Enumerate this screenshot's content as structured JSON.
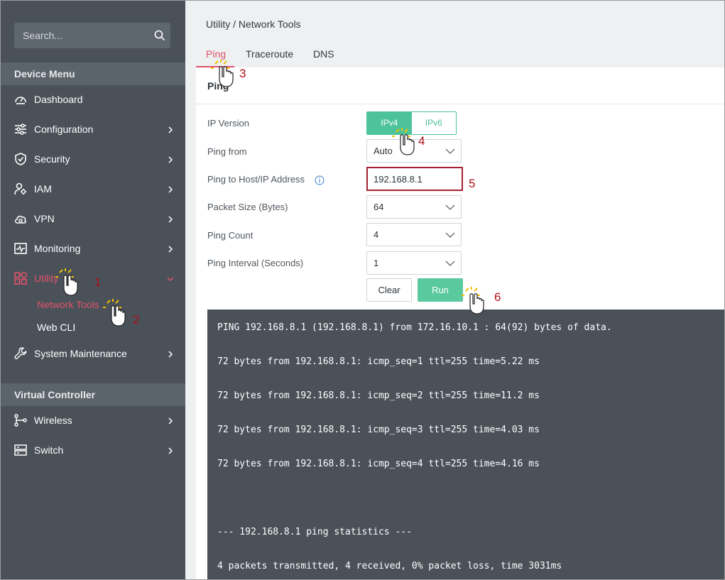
{
  "sidebar": {
    "search_placeholder": "Search...",
    "device_menu_title": "Device Menu",
    "virtual_controller_title": "Virtual Controller",
    "items": [
      {
        "label": "Dashboard",
        "icon": "dashboard-icon"
      },
      {
        "label": "Configuration",
        "icon": "sliders-icon"
      },
      {
        "label": "Security",
        "icon": "shield-icon"
      },
      {
        "label": "IAM",
        "icon": "user-gear-icon"
      },
      {
        "label": "VPN",
        "icon": "cloud-lock-icon"
      },
      {
        "label": "Monitoring",
        "icon": "monitor-pulse-icon"
      },
      {
        "label": "Utility",
        "icon": "grid-icon"
      },
      {
        "label": "System Maintenance",
        "icon": "wrench-icon"
      }
    ],
    "utility_sub": [
      {
        "label": "Network Tools"
      },
      {
        "label": "Web CLI"
      }
    ],
    "vc_items": [
      {
        "label": "Wireless",
        "icon": "wireless-nodes-icon"
      },
      {
        "label": "Switch",
        "icon": "switch-icon"
      }
    ]
  },
  "main": {
    "breadcrumb": "Utility / Network Tools",
    "tabs": [
      {
        "label": "Ping"
      },
      {
        "label": "Traceroute"
      },
      {
        "label": "DNS"
      }
    ],
    "card_title": "Ping",
    "form": {
      "ip_version_label": "IP Version",
      "ipv4": "IPv4",
      "ipv6": "IPv6",
      "ping_from_label": "Ping from",
      "ping_from_value": "Auto",
      "host_label": "Ping to Host/IP Address",
      "host_value": "192.168.8.1",
      "packet_size_label": "Packet Size (Bytes)",
      "packet_size_value": "64",
      "ping_count_label": "Ping Count",
      "ping_count_value": "4",
      "interval_label": "Ping Interval (Seconds)",
      "interval_value": "1",
      "clear_label": "Clear",
      "run_label": "Run"
    },
    "output": [
      "PING 192.168.8.1 (192.168.8.1) from 172.16.10.1 : 64(92) bytes of data.",
      "72 bytes from 192.168.8.1: icmp_seq=1 ttl=255 time=5.22 ms",
      "72 bytes from 192.168.8.1: icmp_seq=2 ttl=255 time=11.2 ms",
      "72 bytes from 192.168.8.1: icmp_seq=3 ttl=255 time=4.03 ms",
      "72 bytes from 192.168.8.1: icmp_seq=4 ttl=255 time=4.16 ms",
      "--- 192.168.8.1 ping statistics ---",
      "4 packets transmitted, 4 received, 0% packet loss, time 3031ms"
    ]
  },
  "annotations": [
    "1",
    "2",
    "3",
    "4",
    "5",
    "6"
  ],
  "colors": {
    "sidebar_bg": "#4a5159",
    "accent_red": "#e0526b",
    "accent_green": "#4cc39a",
    "terminal_bg": "#4a5159"
  }
}
